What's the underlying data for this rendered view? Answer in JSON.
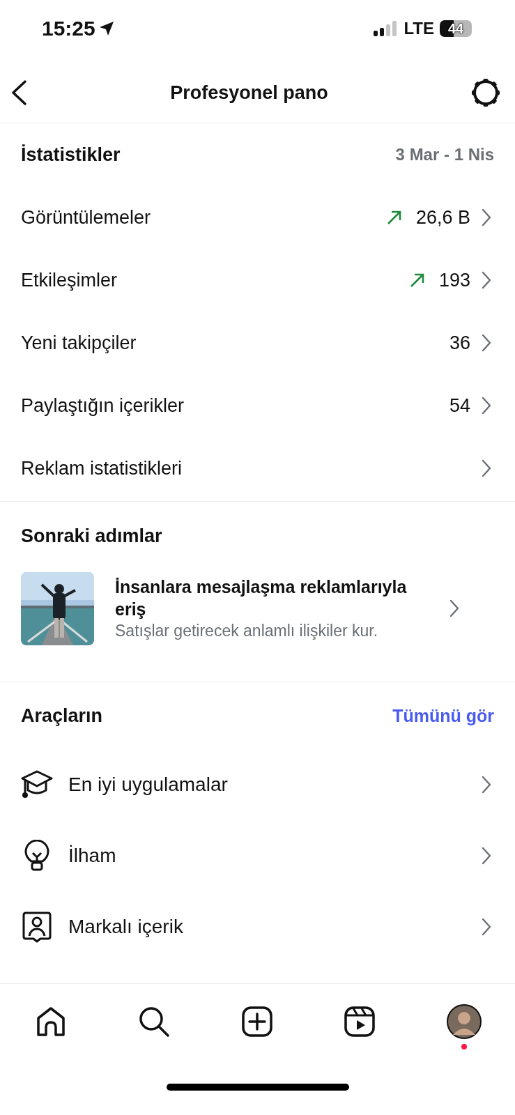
{
  "status_bar": {
    "time": "15:25",
    "network": "LTE",
    "battery": "44"
  },
  "header": {
    "title": "Profesyonel pano"
  },
  "stats": {
    "title": "İstatistikler",
    "date_range": "3 Mar - 1 Nis",
    "rows": [
      {
        "label": "Görüntülemeler",
        "value": "26,6 B",
        "rising": true
      },
      {
        "label": "Etkileşimler",
        "value": "193",
        "rising": true
      },
      {
        "label": "Yeni takipçiler",
        "value": "36",
        "rising": false
      },
      {
        "label": "Paylaştığın içerikler",
        "value": "54",
        "rising": false
      },
      {
        "label": "Reklam istatistikleri",
        "rising": false
      }
    ]
  },
  "next_steps": {
    "title": "Sonraki adımlar",
    "card": {
      "kind": "picture",
      "title": "İnsanlara mesajlaşma reklamlarıyla eriş",
      "subtitle": "Satışlar getirecek anlamlı ilişkiler kur."
    }
  },
  "tools": {
    "title": "Araçların",
    "link": "Tümünü gör",
    "items": [
      {
        "kind": "cap",
        "label": "En iyi uygulamalar"
      },
      {
        "kind": "bulb",
        "label": "İlham"
      },
      {
        "kind": "badge",
        "label": "Markalı içerik"
      }
    ]
  },
  "bottom_nav": {
    "items": [
      {
        "kind": "home"
      },
      {
        "kind": "search"
      },
      {
        "kind": "add"
      },
      {
        "kind": "reels"
      },
      {
        "kind": "profile",
        "notification": true
      }
    ]
  }
}
